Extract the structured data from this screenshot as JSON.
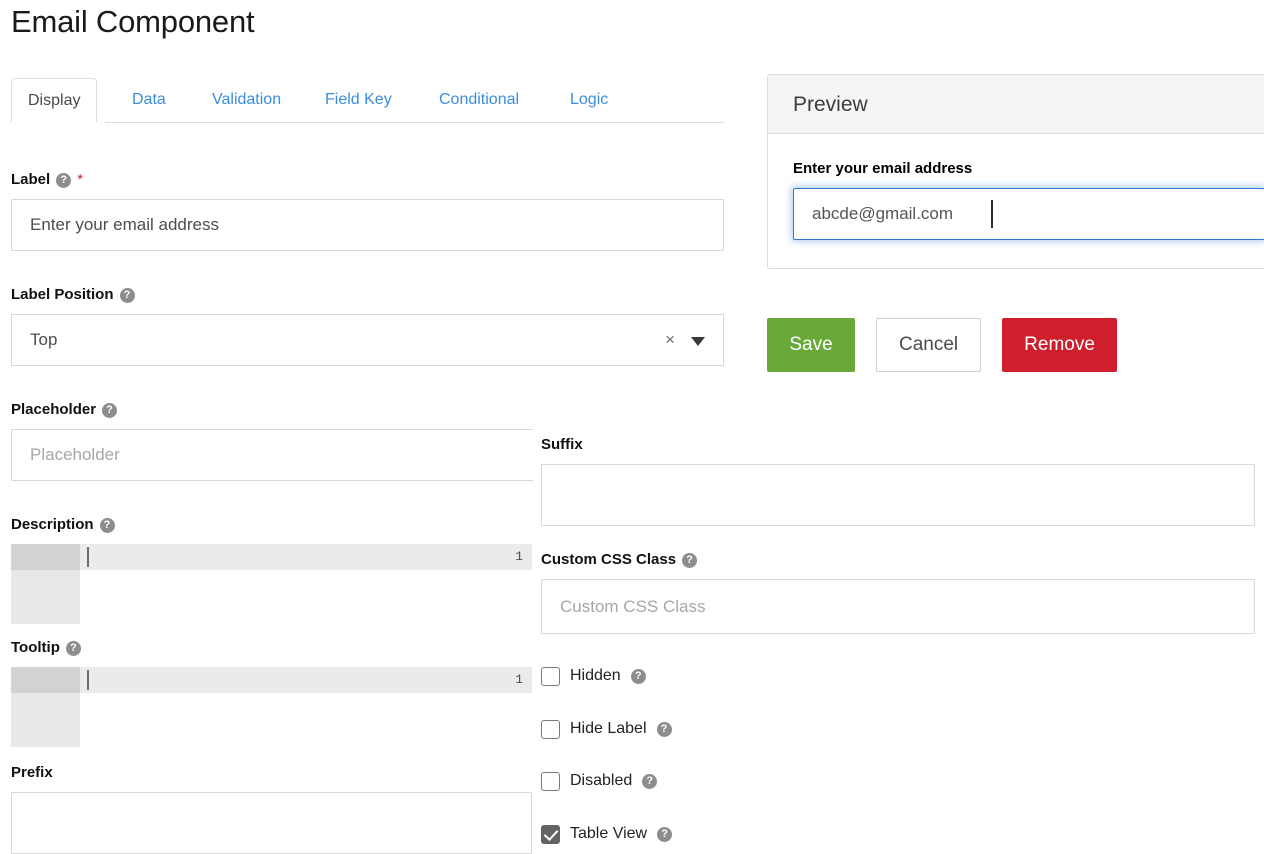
{
  "header": {
    "title": "Email Component"
  },
  "tabs": [
    {
      "label": "Display",
      "active": true
    },
    {
      "label": "Data",
      "active": false
    },
    {
      "label": "Validation",
      "active": false
    },
    {
      "label": "Field Key",
      "active": false
    },
    {
      "label": "Conditional",
      "active": false
    },
    {
      "label": "Logic",
      "active": false
    }
  ],
  "form": {
    "label": {
      "label": "Label",
      "required_marker": "*",
      "help_icon": "question-circle-icon",
      "value": "Enter your email address",
      "placeholder": ""
    },
    "label_position": {
      "label": "Label Position",
      "help_icon": "question-circle-icon",
      "value": "Top",
      "clear_icon": "×",
      "caret_icon": "chevron-down-icon"
    },
    "placeholder": {
      "label": "Placeholder",
      "help_icon": "question-circle-icon",
      "value": "",
      "placeholder": "Placeholder"
    },
    "description": {
      "label": "Description",
      "help_icon": "question-circle-icon",
      "line_number": "1",
      "value": ""
    },
    "tooltip": {
      "label": "Tooltip",
      "help_icon": "question-circle-icon",
      "line_number": "1",
      "value": ""
    },
    "prefix": {
      "label": "Prefix",
      "value": ""
    },
    "suffix": {
      "label": "Suffix",
      "value": ""
    },
    "custom_css_class": {
      "label": "Custom CSS Class",
      "help_icon": "question-circle-icon",
      "value": "",
      "placeholder": "Custom CSS Class"
    },
    "checkboxes": [
      {
        "label": "Hidden",
        "checked": false,
        "help_icon": "question-circle-icon"
      },
      {
        "label": "Hide Label",
        "checked": false,
        "help_icon": "question-circle-icon"
      },
      {
        "label": "Disabled",
        "checked": false,
        "help_icon": "question-circle-icon"
      },
      {
        "label": "Table View",
        "checked": true,
        "help_icon": "question-circle-icon"
      }
    ]
  },
  "preview": {
    "title": "Preview",
    "field_label": "Enter your email address",
    "input_value": "abcde@gmail.com",
    "input_placeholder": ""
  },
  "buttons": {
    "save": "Save",
    "cancel": "Cancel",
    "remove": "Remove"
  },
  "colors": {
    "tab_link": "#3c8dde",
    "save_green": "#6aa83a",
    "remove_red": "#cf1f2c",
    "focus_blue": "#2d7ad4",
    "required_red": "#d9232d",
    "help_gray": "#8d8d8d"
  }
}
